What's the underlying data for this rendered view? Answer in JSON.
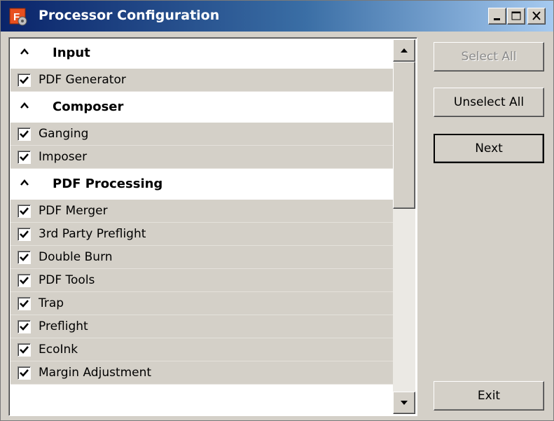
{
  "window": {
    "title": "Processor Configuration",
    "app_icon": "app-icon",
    "controls": [
      "minimize-icon",
      "maximize-icon",
      "close-icon"
    ]
  },
  "groups": [
    {
      "label": "Input",
      "expanded": true,
      "items": [
        {
          "label": "PDF Generator",
          "checked": true
        }
      ]
    },
    {
      "label": "Composer",
      "expanded": true,
      "items": [
        {
          "label": "Ganging",
          "checked": true
        },
        {
          "label": "Imposer",
          "checked": true
        }
      ]
    },
    {
      "label": "PDF Processing",
      "expanded": true,
      "items": [
        {
          "label": "PDF Merger",
          "checked": true
        },
        {
          "label": "3rd Party Preflight",
          "checked": true
        },
        {
          "label": "Double Burn",
          "checked": true
        },
        {
          "label": "PDF Tools",
          "checked": true
        },
        {
          "label": "Trap",
          "checked": true
        },
        {
          "label": "Preflight",
          "checked": true
        },
        {
          "label": "EcoInk",
          "checked": true
        },
        {
          "label": "Margin Adjustment",
          "checked": true
        }
      ]
    }
  ],
  "buttons": {
    "select_all": "Select All",
    "unselect_all": "Unselect All",
    "next": "Next",
    "exit": "Exit"
  },
  "scroll_position": 0
}
